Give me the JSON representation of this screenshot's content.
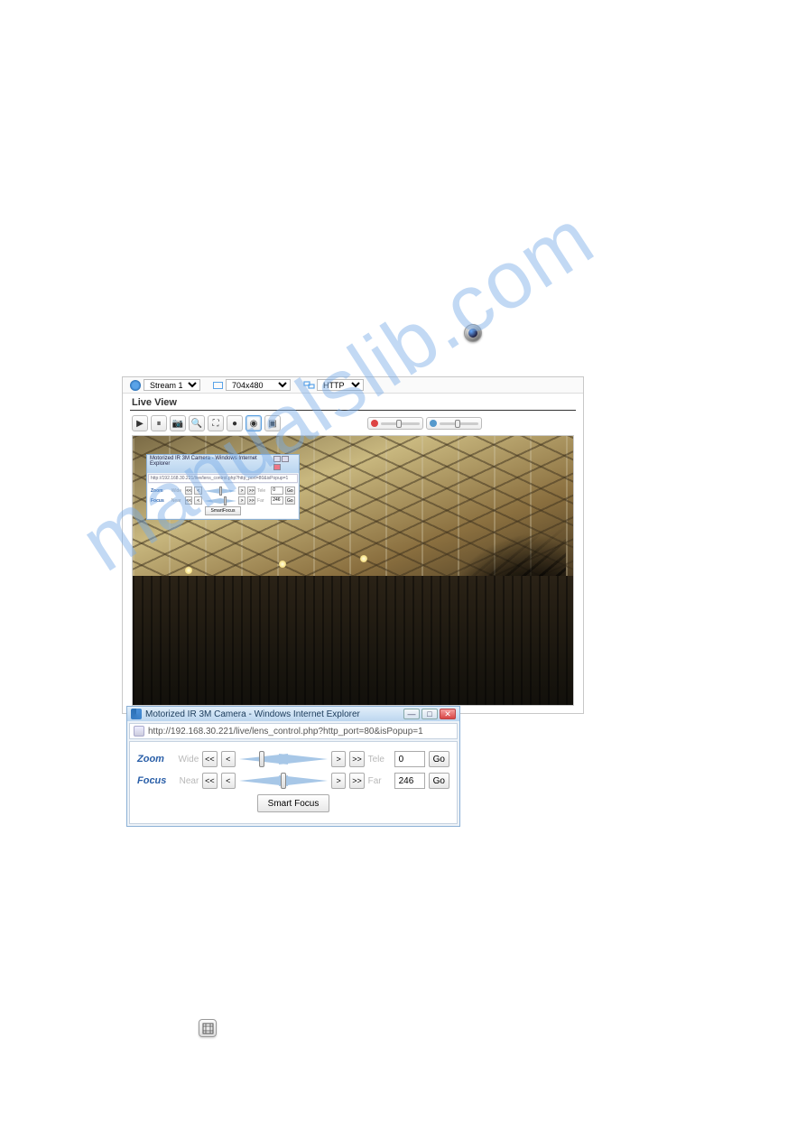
{
  "top_toolbar": {
    "stream_label": "Stream 1",
    "size_label": "704x480",
    "proto_label": "HTTP"
  },
  "live_view": {
    "title": "Live View"
  },
  "mini_popup": {
    "title": "Motorized IR 3M Camera - Windows Internet Explorer",
    "url": "http://192.168.30.221/live/lens_control.php?http_port=80&isPopup=1",
    "zoom_label": "Zoom",
    "focus_label": "Focus",
    "wide": "Wide",
    "tele": "Tele",
    "near": "Near",
    "far": "Far",
    "zoom_val": "0",
    "focus_val": "246",
    "go": "Go",
    "smart": "SmartFocus",
    "step_ll": "<<",
    "step_l": "<",
    "step_r": ">",
    "step_rr": ">>"
  },
  "popup": {
    "title": "Motorized IR 3M Camera - Windows Internet Explorer",
    "url": "http://192.168.30.221/live/lens_control.php?http_port=80&isPopup=1",
    "zoom_label": "Zoom",
    "focus_label": "Focus",
    "wide": "Wide",
    "tele": "Tele",
    "near": "Near",
    "far": "Far",
    "zoom_val": "0",
    "focus_val": "246",
    "go": "Go",
    "smart": "Smart Focus",
    "step_ll": "<<",
    "step_l": "<",
    "step_r": ">",
    "step_rr": ">>"
  }
}
